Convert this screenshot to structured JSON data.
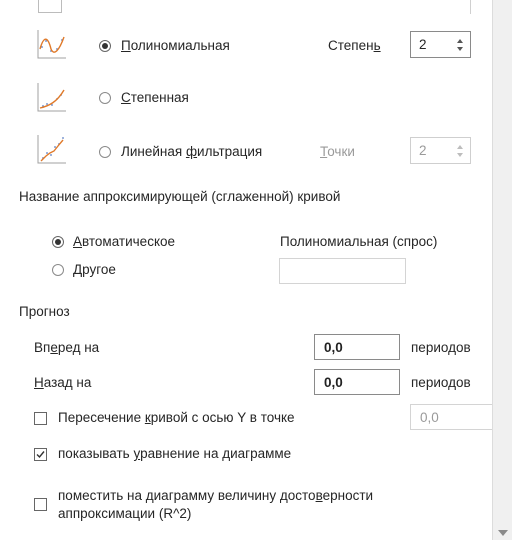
{
  "trendline_types": {
    "polynomial": {
      "label_pre": "",
      "label_u": "П",
      "label_post": "олиномиальная",
      "selected": true,
      "icon": "polynomial-trend-icon"
    },
    "power": {
      "label_pre": "",
      "label_u": "С",
      "label_post": "тепенная",
      "selected": false,
      "icon": "power-trend-icon"
    },
    "moving_average": {
      "label_pre": "Линейная ",
      "label_u": "ф",
      "label_post": "ильтрация",
      "selected": false,
      "icon": "moving-average-trend-icon"
    }
  },
  "order": {
    "label_pre": "Степен",
    "label_u": "ь",
    "value": "2"
  },
  "period": {
    "label_u": "Т",
    "label_post": "очки",
    "value": "2"
  },
  "trendline_name": {
    "heading": "Название аппроксимирующей (сглаженной) кривой",
    "automatic": {
      "label_u": "А",
      "label_post": "втоматическое",
      "selected": true,
      "value": "Полиномиальная (спрос)"
    },
    "custom": {
      "label_u": "Д",
      "label_post": "ругое",
      "selected": false,
      "value": ""
    }
  },
  "forecast": {
    "heading": "Прогноз",
    "forward": {
      "label_pre": "Вп",
      "label_u": "е",
      "label_post": "ред на",
      "value": "0,0",
      "unit": "периодов"
    },
    "backward": {
      "label_pre": "",
      "label_u": "Н",
      "label_post": "азад на",
      "value": "0,0",
      "unit": "периодов"
    }
  },
  "options": {
    "intercept": {
      "label_pre": "Пересечение ",
      "label_u": "к",
      "label_post": "ривой с осью Y в точке",
      "checked": false,
      "value": "0,0"
    },
    "display_equation": {
      "label_pre": "показывать ",
      "label_u": "у",
      "label_post": "равнение на диаграмме",
      "checked": true
    },
    "display_r2": {
      "line1_pre": "поместить на диаграмму величину досто",
      "line1_u": "в",
      "line1_post": "ерности",
      "line2": "аппроксимации (R^2)",
      "checked": false
    }
  },
  "colors": {
    "icon_border": "#a0a0a0",
    "trend_curve": "#e07a2a",
    "dots": "#5a7fc4"
  }
}
